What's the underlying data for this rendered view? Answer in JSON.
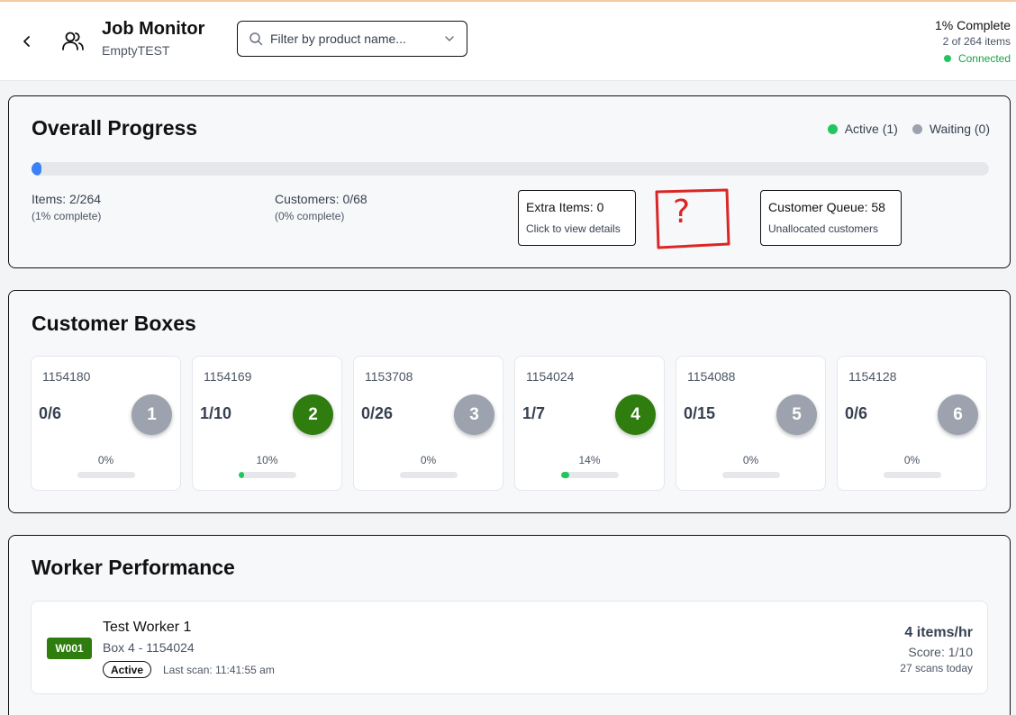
{
  "header": {
    "title": "Job Monitor",
    "subtitle": "EmptyTEST",
    "filter_placeholder": "Filter by product name...",
    "complete_label": "1% Complete",
    "items_label": "2 of 264 items",
    "connection_label": "Connected",
    "connection_color": "#22c55e"
  },
  "overall": {
    "title": "Overall Progress",
    "legend": {
      "active": "Active (1)",
      "waiting": "Waiting (0)"
    },
    "progress_fraction": 0.01,
    "items": {
      "main": "Items: 2/264",
      "sub": "(1% complete)"
    },
    "customers": {
      "main": "Customers: 0/68",
      "sub": "(0% complete)"
    },
    "extra": {
      "main": "Extra Items: 0",
      "sub": "Click to view details"
    },
    "queue": {
      "main": "Customer Queue: 58",
      "sub": "Unallocated customers"
    },
    "annotation_text": "?"
  },
  "boxes": {
    "title": "Customer Boxes",
    "cards": [
      {
        "id": "1154180",
        "count": "0/6",
        "number": "1",
        "percent": "0%",
        "fraction": 0,
        "active": false
      },
      {
        "id": "1154169",
        "count": "1/10",
        "number": "2",
        "percent": "10%",
        "fraction": 0.1,
        "active": true
      },
      {
        "id": "1153708",
        "count": "0/26",
        "number": "3",
        "percent": "0%",
        "fraction": 0,
        "active": false
      },
      {
        "id": "1154024",
        "count": "1/7",
        "number": "4",
        "percent": "14%",
        "fraction": 0.14,
        "active": true
      },
      {
        "id": "1154088",
        "count": "0/15",
        "number": "5",
        "percent": "0%",
        "fraction": 0,
        "active": false
      },
      {
        "id": "1154128",
        "count": "0/6",
        "number": "6",
        "percent": "0%",
        "fraction": 0,
        "active": false
      }
    ],
    "active_color": "#2f7d0f",
    "inactive_color": "#9ca3af"
  },
  "workers": {
    "title": "Worker Performance",
    "list": [
      {
        "code": "W001",
        "name": "Test Worker 1",
        "box": "Box 4 - 1154024",
        "status": "Active",
        "last_scan": "Last scan: 11:41:55 am",
        "rate": "4 items/hr",
        "score": "Score: 1/10",
        "scans": "27 scans today"
      }
    ]
  }
}
